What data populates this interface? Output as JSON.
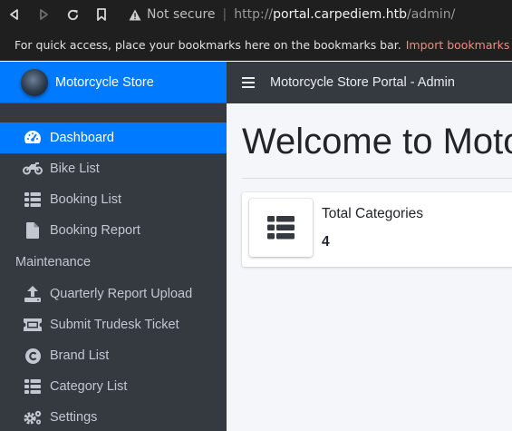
{
  "browser": {
    "security_label": "Not secure",
    "url_scheme": "http://",
    "url_host": "portal.carpediem.htb",
    "url_path": "/admin/",
    "bookmarks_hint": "For quick access, place your bookmarks here on the bookmarks bar.",
    "bookmarks_import": "Import bookmarks now..."
  },
  "sidebar": {
    "brand": "Motorcycle Store",
    "items": [
      {
        "label": "Dashboard",
        "icon": "tachometer-icon",
        "active": true
      },
      {
        "label": "Bike List",
        "icon": "motorcycle-icon"
      },
      {
        "label": "Booking List",
        "icon": "list-icon"
      },
      {
        "label": "Booking Report",
        "icon": "file-icon"
      }
    ],
    "section_header": "Maintenance",
    "maintenance_items": [
      {
        "label": "Quarterly Report Upload",
        "icon": "upload-icon"
      },
      {
        "label": "Submit Trudesk Ticket",
        "icon": "ticket-icon"
      },
      {
        "label": "Brand List",
        "icon": "copyright-icon"
      },
      {
        "label": "Category List",
        "icon": "list-icon"
      },
      {
        "label": "Settings",
        "icon": "cogs-icon"
      }
    ]
  },
  "topnav": {
    "title": "Motorcycle Store Portal - Admin"
  },
  "main": {
    "heading": "Welcome to Moto",
    "info_box": {
      "title": "Total Categories",
      "value": "4",
      "icon": "list-icon"
    }
  },
  "colors": {
    "sidebar_bg": "#343a40",
    "accent": "#007bff",
    "browser_bg": "#1f1f1f",
    "import_link": "#f28b82"
  }
}
